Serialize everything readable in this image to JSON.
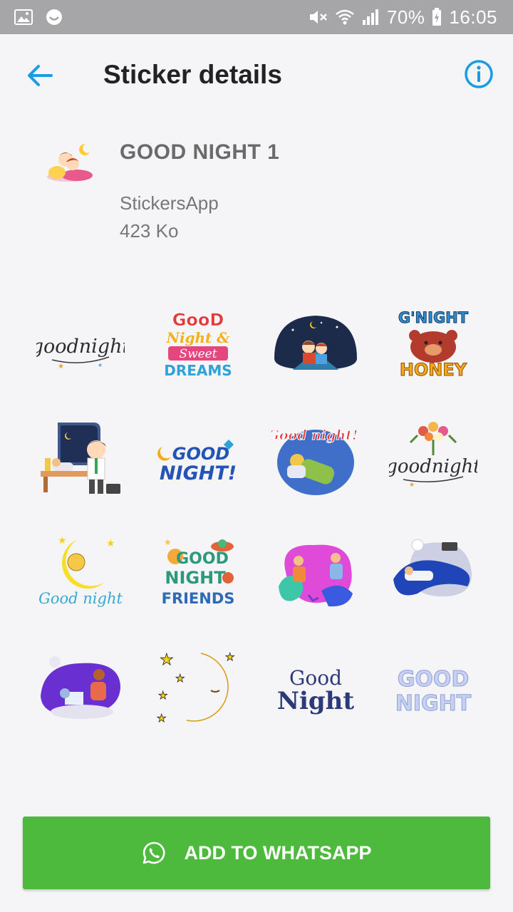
{
  "status_bar": {
    "battery": "70%",
    "time": "16:05",
    "icons": [
      "image-icon",
      "smiley-icon",
      "mute-icon",
      "wifi-icon",
      "signal-icon",
      "battery-icon"
    ]
  },
  "app_bar": {
    "title": "Sticker details",
    "back_icon": "arrow-left-icon",
    "info_icon": "info-icon",
    "accent": "#1a9be6"
  },
  "pack": {
    "name": "GOOD NIGHT 1",
    "author": "StickersApp",
    "size": "423 Ko"
  },
  "stickers": [
    {
      "text": "goodnight"
    },
    {
      "text": "Good Night & Sweet DREAMS"
    },
    {
      "text": ""
    },
    {
      "text": "G'NIGHT HONEY"
    },
    {
      "text": ""
    },
    {
      "text": "GOOD NIGHT!"
    },
    {
      "text": "Good night!"
    },
    {
      "text": "goodnight"
    },
    {
      "text": "Good night"
    },
    {
      "text": "GOOD NIGHT FRIENDS"
    },
    {
      "text": ""
    },
    {
      "text": ""
    },
    {
      "text": ""
    },
    {
      "text": ""
    },
    {
      "text": "Good Night"
    },
    {
      "text": "GOOD NIGHT"
    }
  ],
  "action_button": {
    "label": "ADD TO WHATSAPP",
    "icon": "whatsapp-icon",
    "color": "#4dba3e"
  }
}
